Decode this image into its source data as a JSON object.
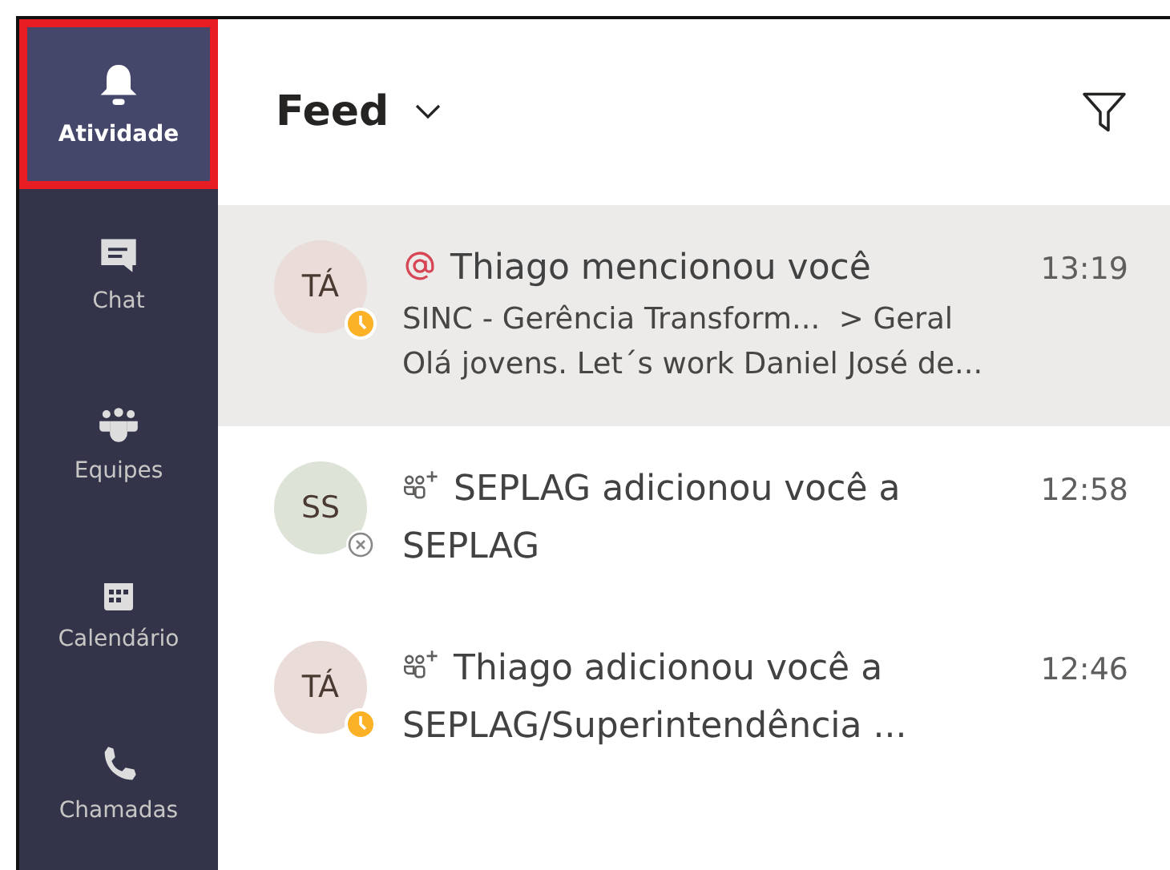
{
  "sidebar": {
    "items": [
      {
        "label": "Atividade",
        "kind": "bell",
        "selected": true,
        "highlighted": true
      },
      {
        "label": "Chat",
        "kind": "chat",
        "selected": false,
        "highlighted": false
      },
      {
        "label": "Equipes",
        "kind": "teams",
        "selected": false,
        "highlighted": false
      },
      {
        "label": "Calendário",
        "kind": "calendar",
        "selected": false,
        "highlighted": false
      },
      {
        "label": "Chamadas",
        "kind": "phone",
        "selected": false,
        "highlighted": false
      }
    ]
  },
  "feed": {
    "title": "Feed",
    "items": [
      {
        "avatar": {
          "initials": "TÁ",
          "color": "#eadcd9",
          "kind": "away"
        },
        "kind": "mention",
        "title": "Thiago mencionou você",
        "time": "13:19",
        "lines": [
          "SINC - Gerência Transform...  > Geral",
          "Olá jovens. Let´s work Daniel José de..."
        ],
        "selected": true
      },
      {
        "avatar": {
          "initials": "SS",
          "color": "#dde3d7",
          "kind": "offline"
        },
        "kind": "added",
        "title": "SEPLAG adicionou você a SEPLAG",
        "time": "12:58",
        "selected": false
      },
      {
        "avatar": {
          "initials": "TÁ",
          "color": "#eadcd9",
          "kind": "away"
        },
        "kind": "added",
        "title": "Thiago adicionou você a SEPLAG/Superintendência ...",
        "time": "12:46",
        "selected": false
      }
    ]
  }
}
